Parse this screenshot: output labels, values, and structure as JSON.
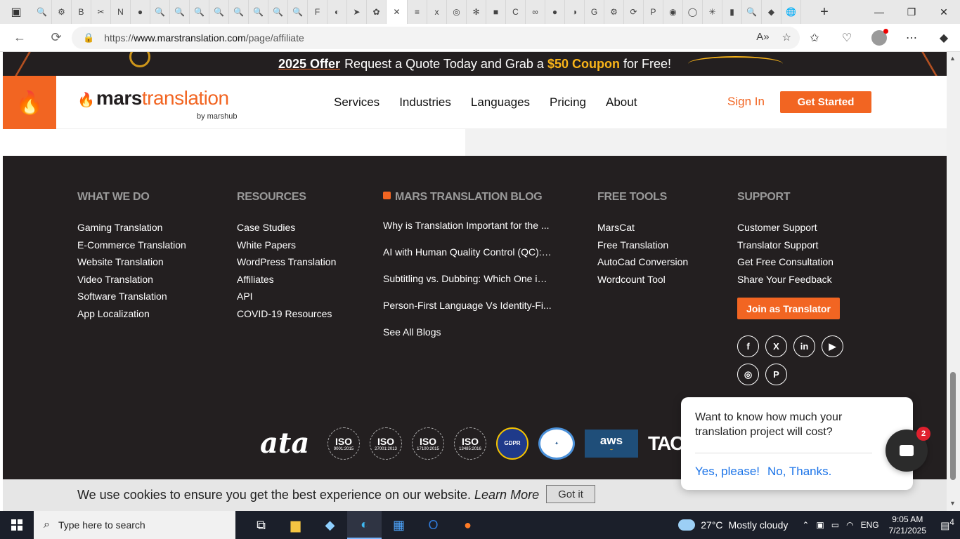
{
  "browser": {
    "url_prefix": "https://",
    "url_domain": "www.marstranslation.com",
    "url_path": "/page/affiliate"
  },
  "promo": {
    "offer": "2025 Offer",
    "text_before": "Request a Quote Today and Grab a",
    "coupon": "$50 Coupon",
    "text_after": "for Free!"
  },
  "header": {
    "logo_mars": "mars",
    "logo_translation": "translation",
    "logo_by": "by marshub",
    "nav": [
      "Services",
      "Industries",
      "Languages",
      "Pricing",
      "About"
    ],
    "sign_in": "Sign In",
    "get_started": "Get Started"
  },
  "footer": {
    "what_we_do": {
      "title": "WHAT WE DO",
      "links": [
        "Gaming Translation",
        "E-Commerce Translation",
        "Website Translation",
        "Video Translation",
        "Software Translation",
        "App Localization"
      ]
    },
    "resources": {
      "title": "RESOURCES",
      "links": [
        "Case Studies",
        "White Papers",
        "WordPress Translation",
        "Affiliates",
        "API",
        "COVID-19 Resources"
      ]
    },
    "blog": {
      "title": "MARS TRANSLATION BLOG",
      "links": [
        "Why is Translation Important for the ...",
        "AI with Human Quality Control (QC): ...",
        "Subtitling vs. Dubbing: Which One is ...",
        "Person-First Language Vs Identity-Fi...",
        "See All Blogs"
      ]
    },
    "free_tools": {
      "title": "FREE TOOLS",
      "links": [
        "MarsCat",
        "Free Translation",
        "AutoCad Conversion",
        "Wordcount Tool"
      ]
    },
    "support": {
      "title": "SUPPORT",
      "links": [
        "Customer Support",
        "Translator Support",
        "Get Free Consultation",
        "Share Your Feedback"
      ],
      "join_button": "Join as Translator"
    },
    "socials": [
      "f",
      "X",
      "in",
      "▶",
      "◎",
      "P"
    ],
    "badges": {
      "ata": "ata",
      "iso": [
        {
          "label": "ISO",
          "code": "9001:2015"
        },
        {
          "label": "ISO",
          "code": "27001:2013"
        },
        {
          "label": "ISO",
          "code": "17100:2015"
        },
        {
          "label": "ISO",
          "code": "13485:2016"
        }
      ],
      "gdpr": "GDPR",
      "aws": "aws",
      "tac": "TAC"
    }
  },
  "cookie": {
    "message": "We use cookies to ensure you get the best experience on our website.",
    "learn_more": "Learn More",
    "button": "Got it"
  },
  "chat": {
    "question": "Want to know how much your translation project will cost?",
    "yes": "Yes, please!",
    "no": "No, Thanks.",
    "badge_count": "2"
  },
  "taskbar": {
    "search_placeholder": "Type here to search",
    "weather_temp": "27°C",
    "weather_text": "Mostly cloudy",
    "language": "ENG",
    "time": "9:05 AM",
    "date": "7/21/2025",
    "notification_count": "4"
  }
}
